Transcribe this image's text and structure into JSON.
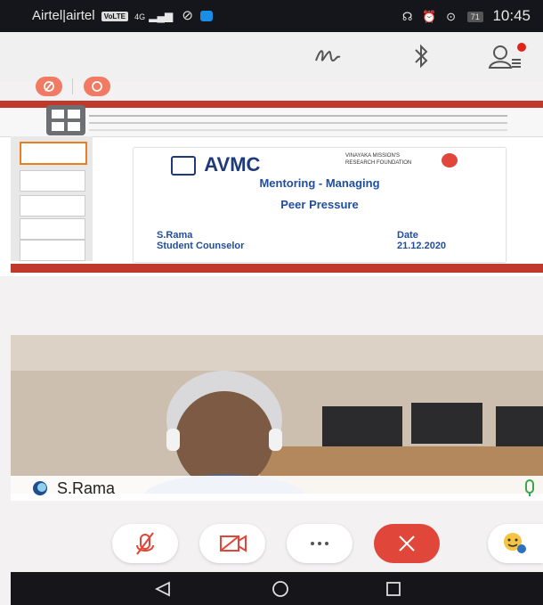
{
  "status_bar": {
    "carrier": "Airtel|airtel",
    "volte": "VoLTE",
    "network": "4G",
    "battery": "71",
    "time": "10:45"
  },
  "slide": {
    "logo_left": "AVMC",
    "logo_right_line1": "VINAYAKA MISSION'S",
    "logo_right_line2": "RESEARCH FOUNDATION",
    "title_line1": "Mentoring - Managing",
    "title_line2": "Peer Pressure",
    "presenter_name": "S.Rama",
    "presenter_role": "Student Counselor",
    "date_label": "Date",
    "date_value": "21.12.2020"
  },
  "participant": {
    "name": "S.Rama"
  },
  "colors": {
    "accent_red": "#e0463a",
    "title_blue": "#1f4e9e",
    "status_bar": "#15161b"
  }
}
